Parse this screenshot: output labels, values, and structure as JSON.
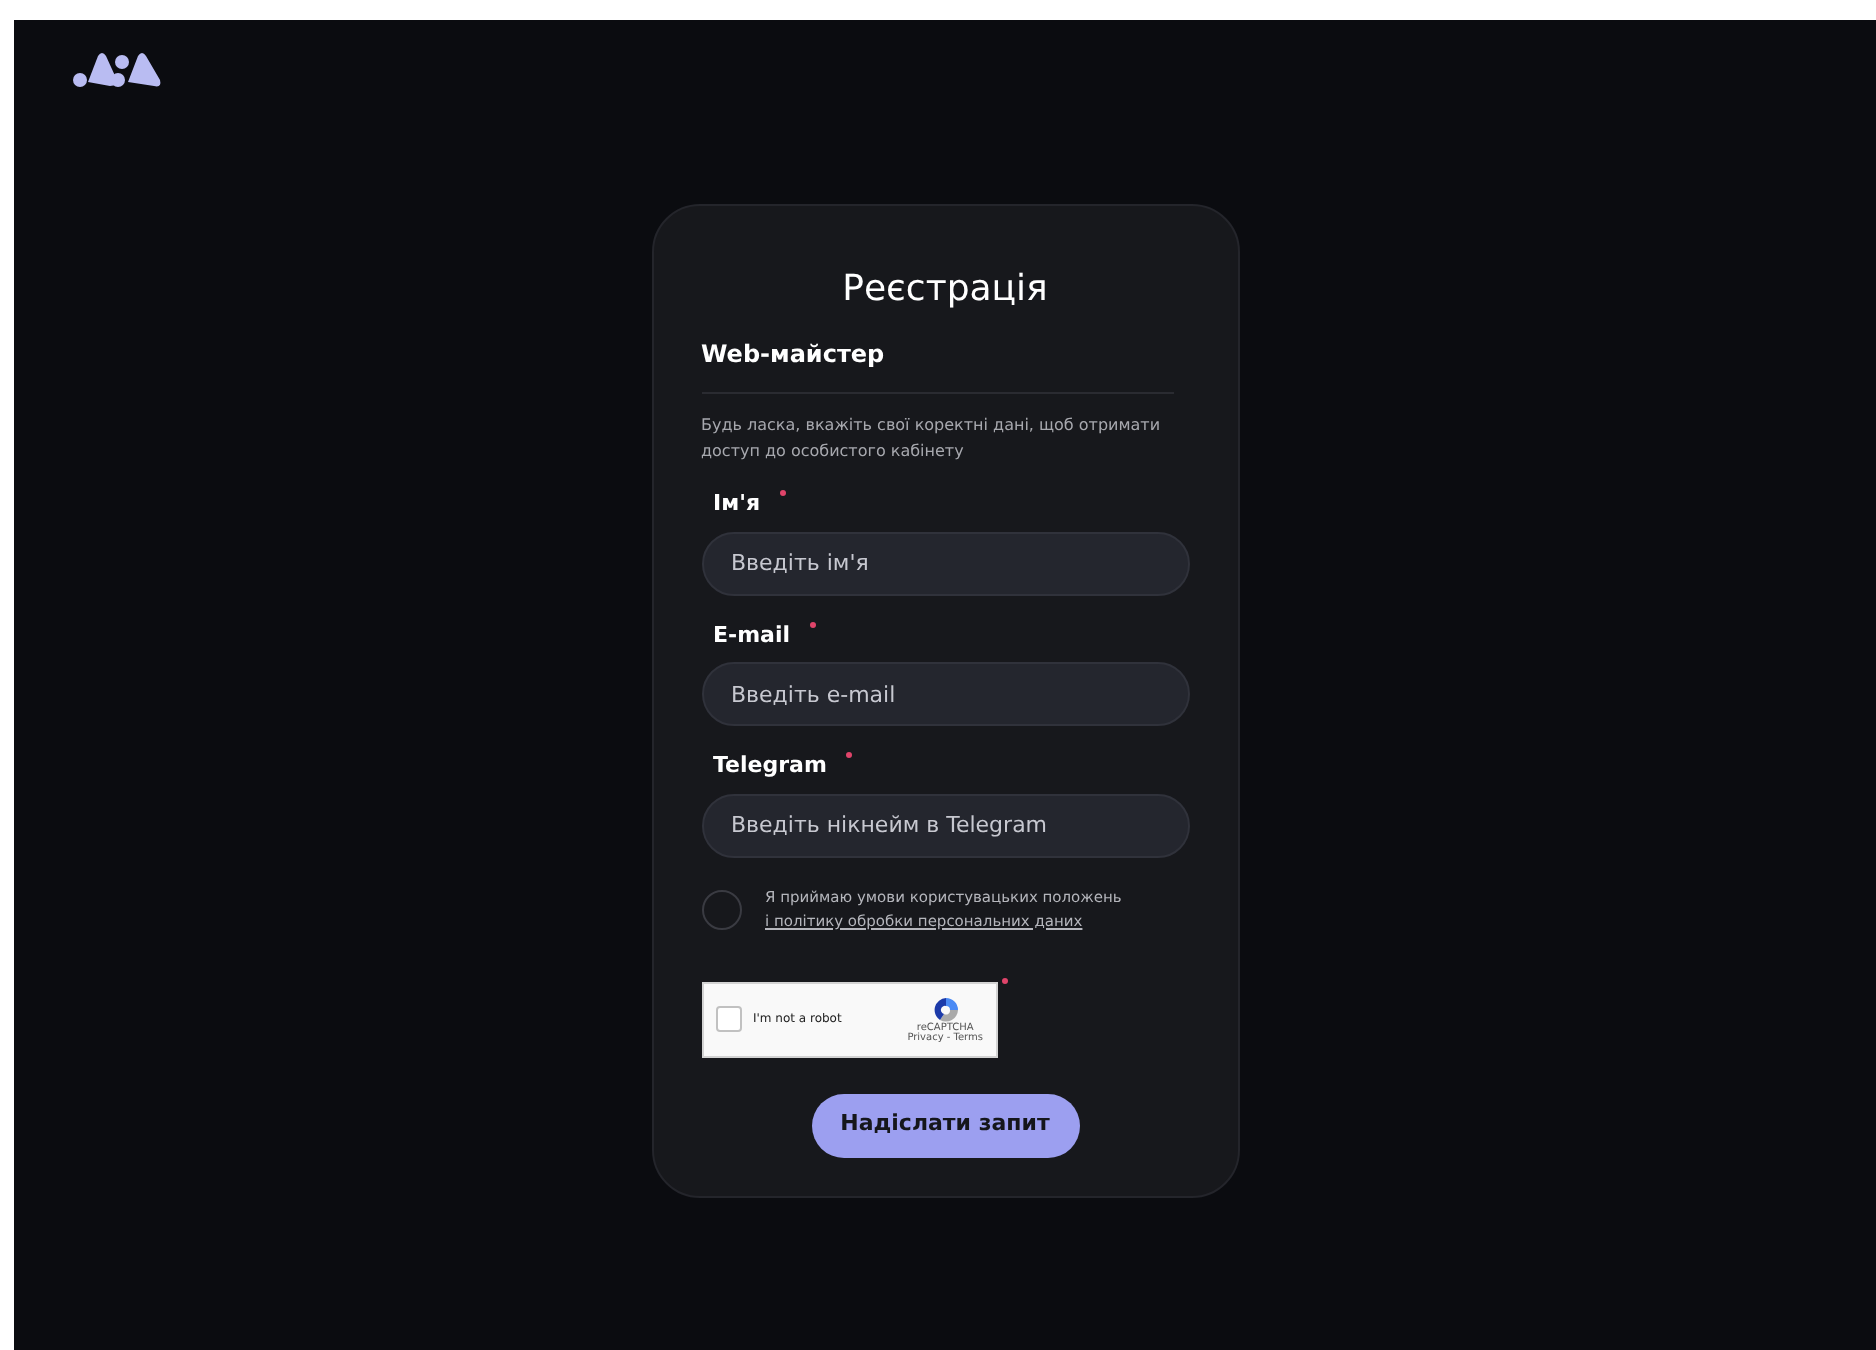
{
  "title": "Реєстрація",
  "role": "Web-майстер",
  "description": "Будь ласка, вкажіть свої коректні дані, щоб отримати доступ до особистого кабінету",
  "fields": [
    {
      "label": "Ім'я",
      "required": true,
      "placeholder": "Введіть ім'я"
    },
    {
      "label": "E-mail",
      "required": true,
      "placeholder": "Введіть e-mail"
    },
    {
      "label": "Telegram",
      "required": true,
      "placeholder": "Введіть нікнейм в Telegram"
    }
  ],
  "agreement": {
    "checked": false,
    "line_1": "Я приймаю умови користувацьких положень",
    "link": "і політику обробки персональних даних"
  },
  "captcha": {
    "checked": false,
    "label": "I'm not a robot",
    "brand": "reCAPTCHA",
    "links": "Privacy - Terms",
    "required": true
  },
  "submit": "Надіслати запит"
}
